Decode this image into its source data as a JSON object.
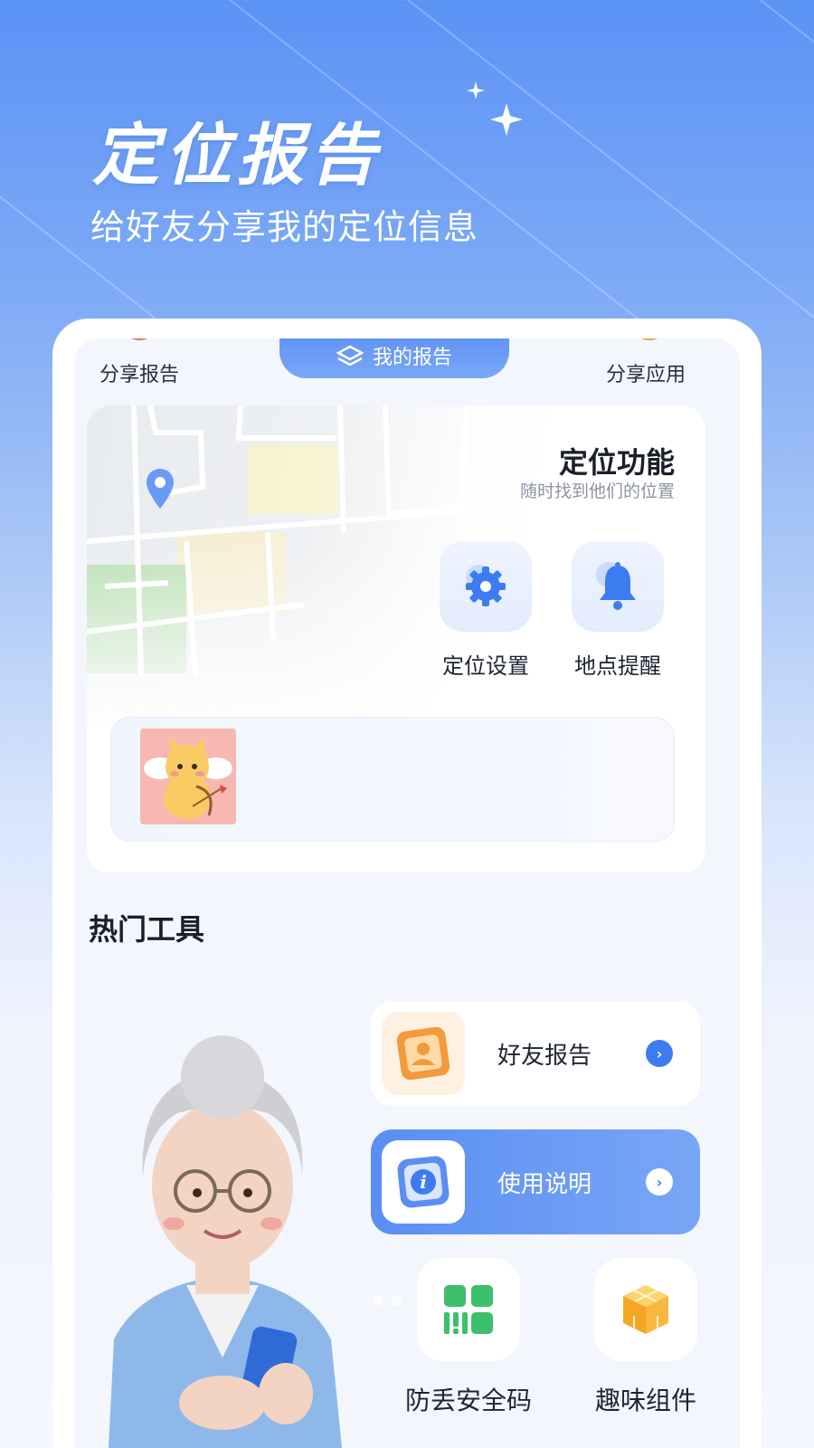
{
  "hero": {
    "title": "定位报告",
    "subtitle": "给好友分享我的定位信息"
  },
  "top_nav": {
    "left_label": "分享报告",
    "center_label": "我的报告",
    "right_label": "分享应用"
  },
  "location_feature": {
    "title": "定位功能",
    "subtitle": "随时找到他们的位置",
    "buttons": [
      {
        "label": "定位设置",
        "icon": "gear-icon"
      },
      {
        "label": "地点提醒",
        "icon": "bell-icon"
      }
    ]
  },
  "hot_tools": {
    "title": "热门工具",
    "cards": [
      {
        "label": "好友报告",
        "icon": "friend-report-icon"
      },
      {
        "label": "使用说明",
        "icon": "info-icon"
      }
    ],
    "small_tools": [
      {
        "label": "防丢安全码",
        "icon": "qr-code-icon"
      },
      {
        "label": "趣味组件",
        "icon": "cube-icon"
      }
    ]
  },
  "colors": {
    "primary": "#5b93f5",
    "accent_orange": "#f39a3c",
    "text": "#1d2433"
  }
}
